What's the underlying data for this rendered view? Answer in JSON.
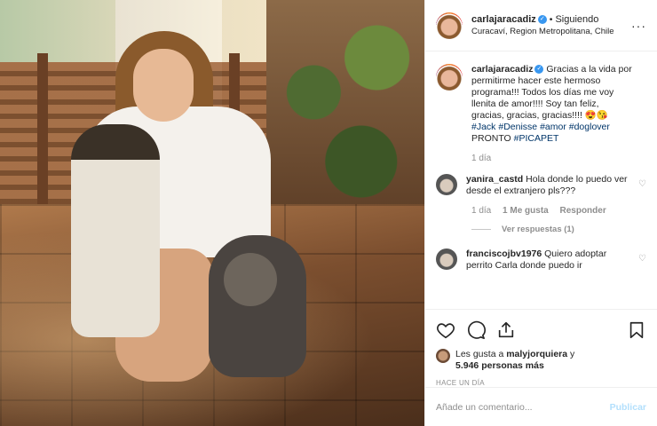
{
  "header": {
    "username": "carlajaracadiz",
    "separator": "•",
    "follow_status": "Siguiendo",
    "location": "Curacaví, Region Metropolitana, Chile",
    "more": "···"
  },
  "caption": {
    "username": "carlajaracadiz",
    "text": "Gracias a la vida por permitirme hacer este hermoso programa!!! Todos los días me voy llenita de amor!!!! Soy tan feliz, gracias, gracias, gracias!!!! 😍😘",
    "tags": [
      "#Jack",
      "#Denisse",
      "#amor",
      "#doglover"
    ],
    "suffix_prefix": "PRONTO",
    "suffix_tag": "#PICAPET",
    "time": "1 día"
  },
  "comments": [
    {
      "username": "yanira_castd",
      "text": "Hola donde lo puedo ver desde el extranjero pls???",
      "time": "1 día",
      "likes": "1 Me gusta",
      "reply": "Responder",
      "view_replies": "Ver respuestas (1)"
    },
    {
      "username": "franciscojbv1976",
      "text": "Quiero adoptar perrito Carla donde puedo ir"
    }
  ],
  "likes": {
    "prefix": "Les gusta a",
    "user": "malyjorquiera",
    "conj": "y",
    "count": "5.946 personas más"
  },
  "date": "HACE UN DÍA",
  "add_comment": {
    "placeholder": "Añade un comentario...",
    "publish": "Publicar"
  },
  "colors": {
    "link": "#003569",
    "verified": "#3897f0",
    "muted": "#8e8e8e",
    "publish_disabled": "#b2dffc"
  }
}
